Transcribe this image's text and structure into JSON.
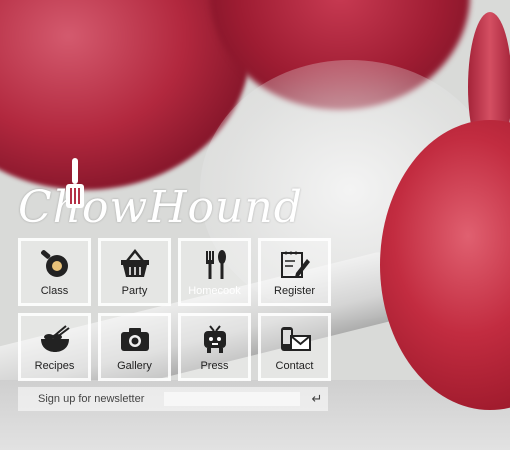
{
  "brand": {
    "logo_text": "ChowHound"
  },
  "menu": [
    {
      "id": "class",
      "label": "Class",
      "icon": "frying-pan-icon"
    },
    {
      "id": "party",
      "label": "Party",
      "icon": "basket-icon"
    },
    {
      "id": "homecook",
      "label": "Homecook",
      "icon": "cutlery-icon"
    },
    {
      "id": "register",
      "label": "Register",
      "icon": "notepad-pencil-icon"
    },
    {
      "id": "recipes",
      "label": "Recipes",
      "icon": "bowl-chopsticks-icon"
    },
    {
      "id": "gallery",
      "label": "Gallery",
      "icon": "camera-icon"
    },
    {
      "id": "press",
      "label": "Press",
      "icon": "tv-character-icon"
    },
    {
      "id": "contact",
      "label": "Contact",
      "icon": "phone-mail-icon"
    }
  ],
  "newsletter": {
    "label": "Sign up for newsletter",
    "value": "",
    "submit_icon": "enter-return-icon"
  }
}
